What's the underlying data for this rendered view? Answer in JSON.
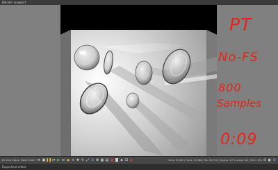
{
  "window": {
    "title": "Blender viewport"
  },
  "annotation": {
    "color": "#e8231c",
    "lines": [
      "PT",
      "No-FS",
      "800",
      "Samples",
      "0:09"
    ]
  },
  "toolbar": {
    "status_left": "3D View  Object Mode  Orbit  Fill Chat  Global",
    "stats": "Verts: 15,369 | Faces: 15,360 | Tris: 30,720 | Objects: 1/7 | Lamps: 0/2 | Mem: 65.24M"
  },
  "footer": {
    "label": "Dopesheet editor"
  },
  "scene": {
    "render_background": "#ffffff",
    "letterbox_color": "#000000",
    "viewport_bg": "#808080"
  }
}
